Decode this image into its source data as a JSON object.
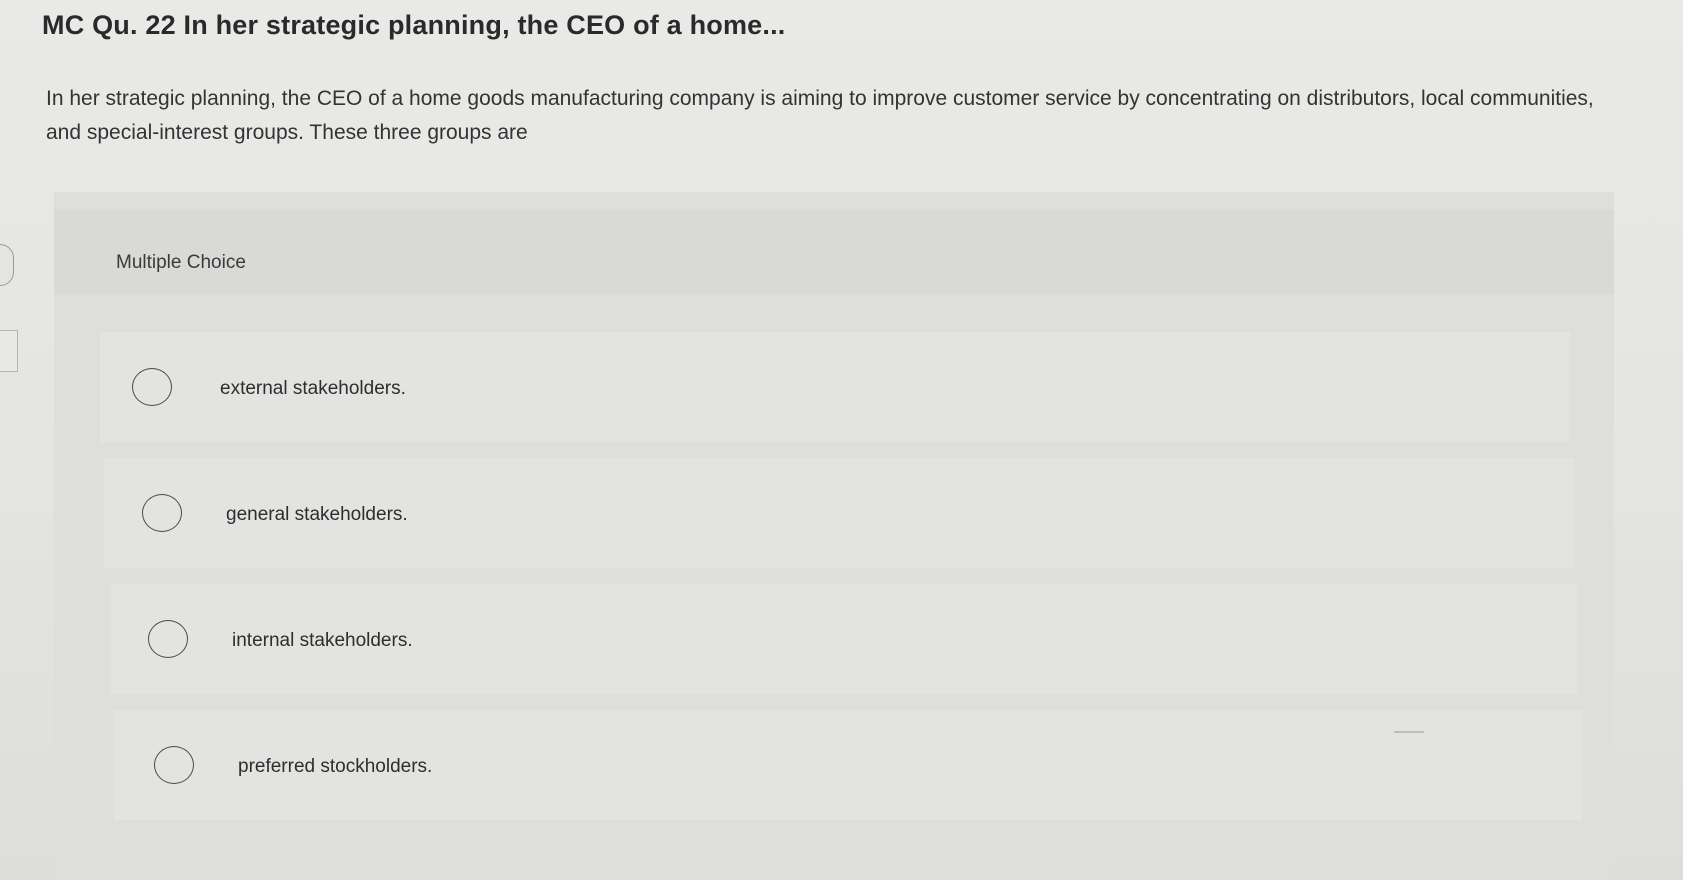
{
  "header": {
    "title": "MC Qu. 22 In her strategic planning, the CEO of a home..."
  },
  "question": {
    "text": "In her strategic planning, the CEO of a home goods manufacturing company is aiming to improve customer service by concentrating on distributors, local communities, and special-interest groups. These three groups are"
  },
  "multiple_choice": {
    "label": "Multiple Choice",
    "options": [
      {
        "label": "external stakeholders."
      },
      {
        "label": "general stakeholders."
      },
      {
        "label": "internal stakeholders."
      },
      {
        "label": "preferred stockholders."
      }
    ]
  }
}
